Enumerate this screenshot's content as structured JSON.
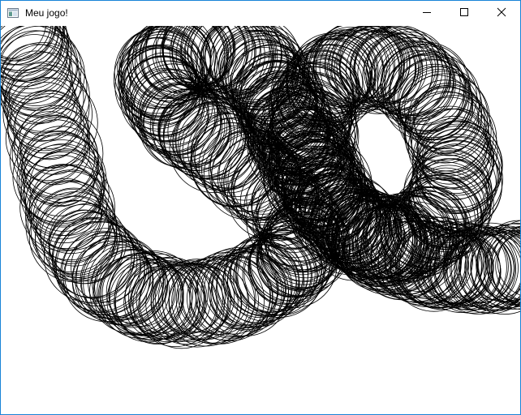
{
  "window": {
    "title": "Meu jogo!",
    "accent_color": "#1883d7",
    "buttons": {
      "minimize_icon": "minimize-icon",
      "maximize_icon": "maximize-icon",
      "close_icon": "close-icon"
    }
  },
  "canvas": {
    "background": "#ffffff",
    "stroke_color": "#000000",
    "drawing": "overlapping-circle-trail"
  }
}
